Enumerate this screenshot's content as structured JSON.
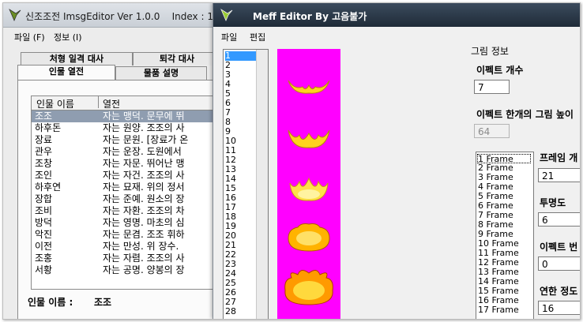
{
  "back_window": {
    "title": "신조조전 ImsgEditor Ver 1.0.0",
    "index_label": "Index : 1",
    "menu": [
      "파일 (F)",
      "정보 (I)"
    ],
    "tabs_row1": [
      "처형 일격 대사",
      "퇴각 대사"
    ],
    "tabs_row2": [
      "인물 열전",
      "물품 설명"
    ],
    "list": {
      "headers": [
        "인물 이름",
        "열전"
      ],
      "rows": [
        {
          "name": "조조",
          "text": "자는 맹덕. 문무에 뛰"
        },
        {
          "name": "하후돈",
          "text": "자는 원양. 조조의 사"
        },
        {
          "name": "장료",
          "text": "자는 문원. [장료가 온"
        },
        {
          "name": "관우",
          "text": "자는 운장. 도원에서 "
        },
        {
          "name": "조창",
          "text": "자는 자문. 뛰어난 맹"
        },
        {
          "name": "조인",
          "text": "자는 자건. 조조의 사"
        },
        {
          "name": "하후연",
          "text": "자는 묘재. 위의 정서"
        },
        {
          "name": "장합",
          "text": "자는 준예. 원소의 장"
        },
        {
          "name": "조비",
          "text": "자는 자환. 조조의 차"
        },
        {
          "name": "방덕",
          "text": "자는 영명. 마초의 심"
        },
        {
          "name": "악진",
          "text": "자는 문겸. 조조 휘하"
        },
        {
          "name": "이전",
          "text": "자는 만성. 위 장수. "
        },
        {
          "name": "조홍",
          "text": "자는 자렴. 조조의 사"
        },
        {
          "name": "서황",
          "text": "자는 공명. 양봉의 장"
        }
      ]
    },
    "name_label": "인물 이름 :",
    "name_value": "조조"
  },
  "front_window": {
    "title": "Meff Editor   By 고음불가",
    "menu": [
      "파일",
      "편집"
    ],
    "index_items": [
      "1",
      "2",
      "3",
      "4",
      "5",
      "6",
      "7",
      "8",
      "9",
      "10",
      "11",
      "12",
      "13",
      "14",
      "15",
      "16",
      "17",
      "18",
      "19",
      "20",
      "21",
      "22",
      "23",
      "24",
      "25",
      "26",
      "27",
      "28"
    ],
    "selected_index": "1",
    "picture_info_label": "그림 정보",
    "effect_count_label": "이펙트 개수",
    "effect_count_value": "7",
    "effect_height_label": "이펙트 한개의 그림 높이",
    "effect_height_value": "64",
    "frames": [
      "1 Frame",
      "2 Frame",
      "3 Frame",
      "4 Frame",
      "5 Frame",
      "6 Frame",
      "7 Frame",
      "8 Frame",
      "9 Frame",
      "10 Frame",
      "11 Frame",
      "12 Frame",
      "13 Frame",
      "14 Frame",
      "15 Frame",
      "16 Frame",
      "17 Frame"
    ],
    "frame_label": "프레임 개",
    "frame_value": "21",
    "opacity_label": "투명도",
    "opacity_value": "6",
    "effect_change_label": "이펙트 번",
    "effect_change_value": "0",
    "link_label": "연한 정도",
    "link_value": "16"
  },
  "colors": {
    "magenta": "#ff00ff",
    "selection_blue": "#3399ff",
    "selection_gray": "#8f9db0"
  }
}
